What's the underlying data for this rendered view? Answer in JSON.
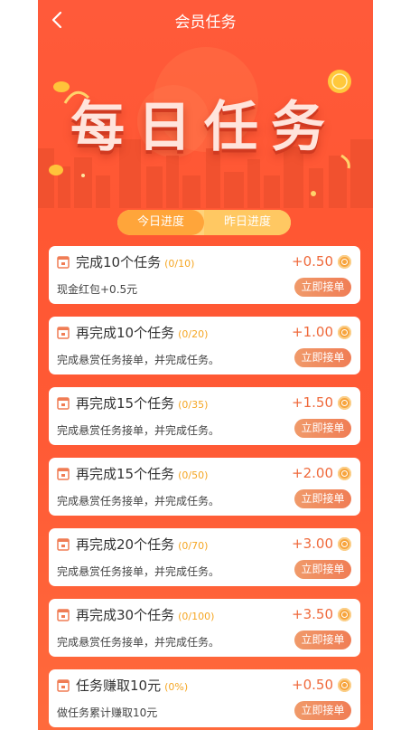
{
  "header": {
    "title": "会员任务"
  },
  "hero": {
    "title": "每日任务"
  },
  "tabs": [
    {
      "label": "今日进度",
      "active": true
    },
    {
      "label": "昨日进度",
      "active": false
    }
  ],
  "tasks": [
    {
      "title": "完成10个任务",
      "progress": "(0/10)",
      "reward": "+0.50",
      "desc": "现金红包+0.5元",
      "button": "立即接单"
    },
    {
      "title": "再完成10个任务",
      "progress": "(0/20)",
      "reward": "+1.00",
      "desc": "完成悬赏任务接单，并完成任务。",
      "button": "立即接单"
    },
    {
      "title": "再完成15个任务",
      "progress": "(0/35)",
      "reward": "+1.50",
      "desc": "完成悬赏任务接单，并完成任务。",
      "button": "立即接单"
    },
    {
      "title": "再完成15个任务",
      "progress": "(0/50)",
      "reward": "+2.00",
      "desc": "完成悬赏任务接单，并完成任务。",
      "button": "立即接单"
    },
    {
      "title": "再完成20个任务",
      "progress": "(0/70)",
      "reward": "+3.00",
      "desc": "完成悬赏任务接单，并完成任务。",
      "button": "立即接单"
    },
    {
      "title": "再完成30个任务",
      "progress": "(0/100)",
      "reward": "+3.50",
      "desc": "完成悬赏任务接单，并完成任务。",
      "button": "立即接单"
    },
    {
      "title": "任务赚取10元",
      "progress": "(0%)",
      "reward": "+0.50",
      "desc": "做任务累计赚取10元",
      "button": "立即接单"
    }
  ],
  "colors": {
    "primary": "#ff5733",
    "accent": "#f07d55",
    "progress": "#f5a623",
    "coin": "#f7a43c"
  }
}
